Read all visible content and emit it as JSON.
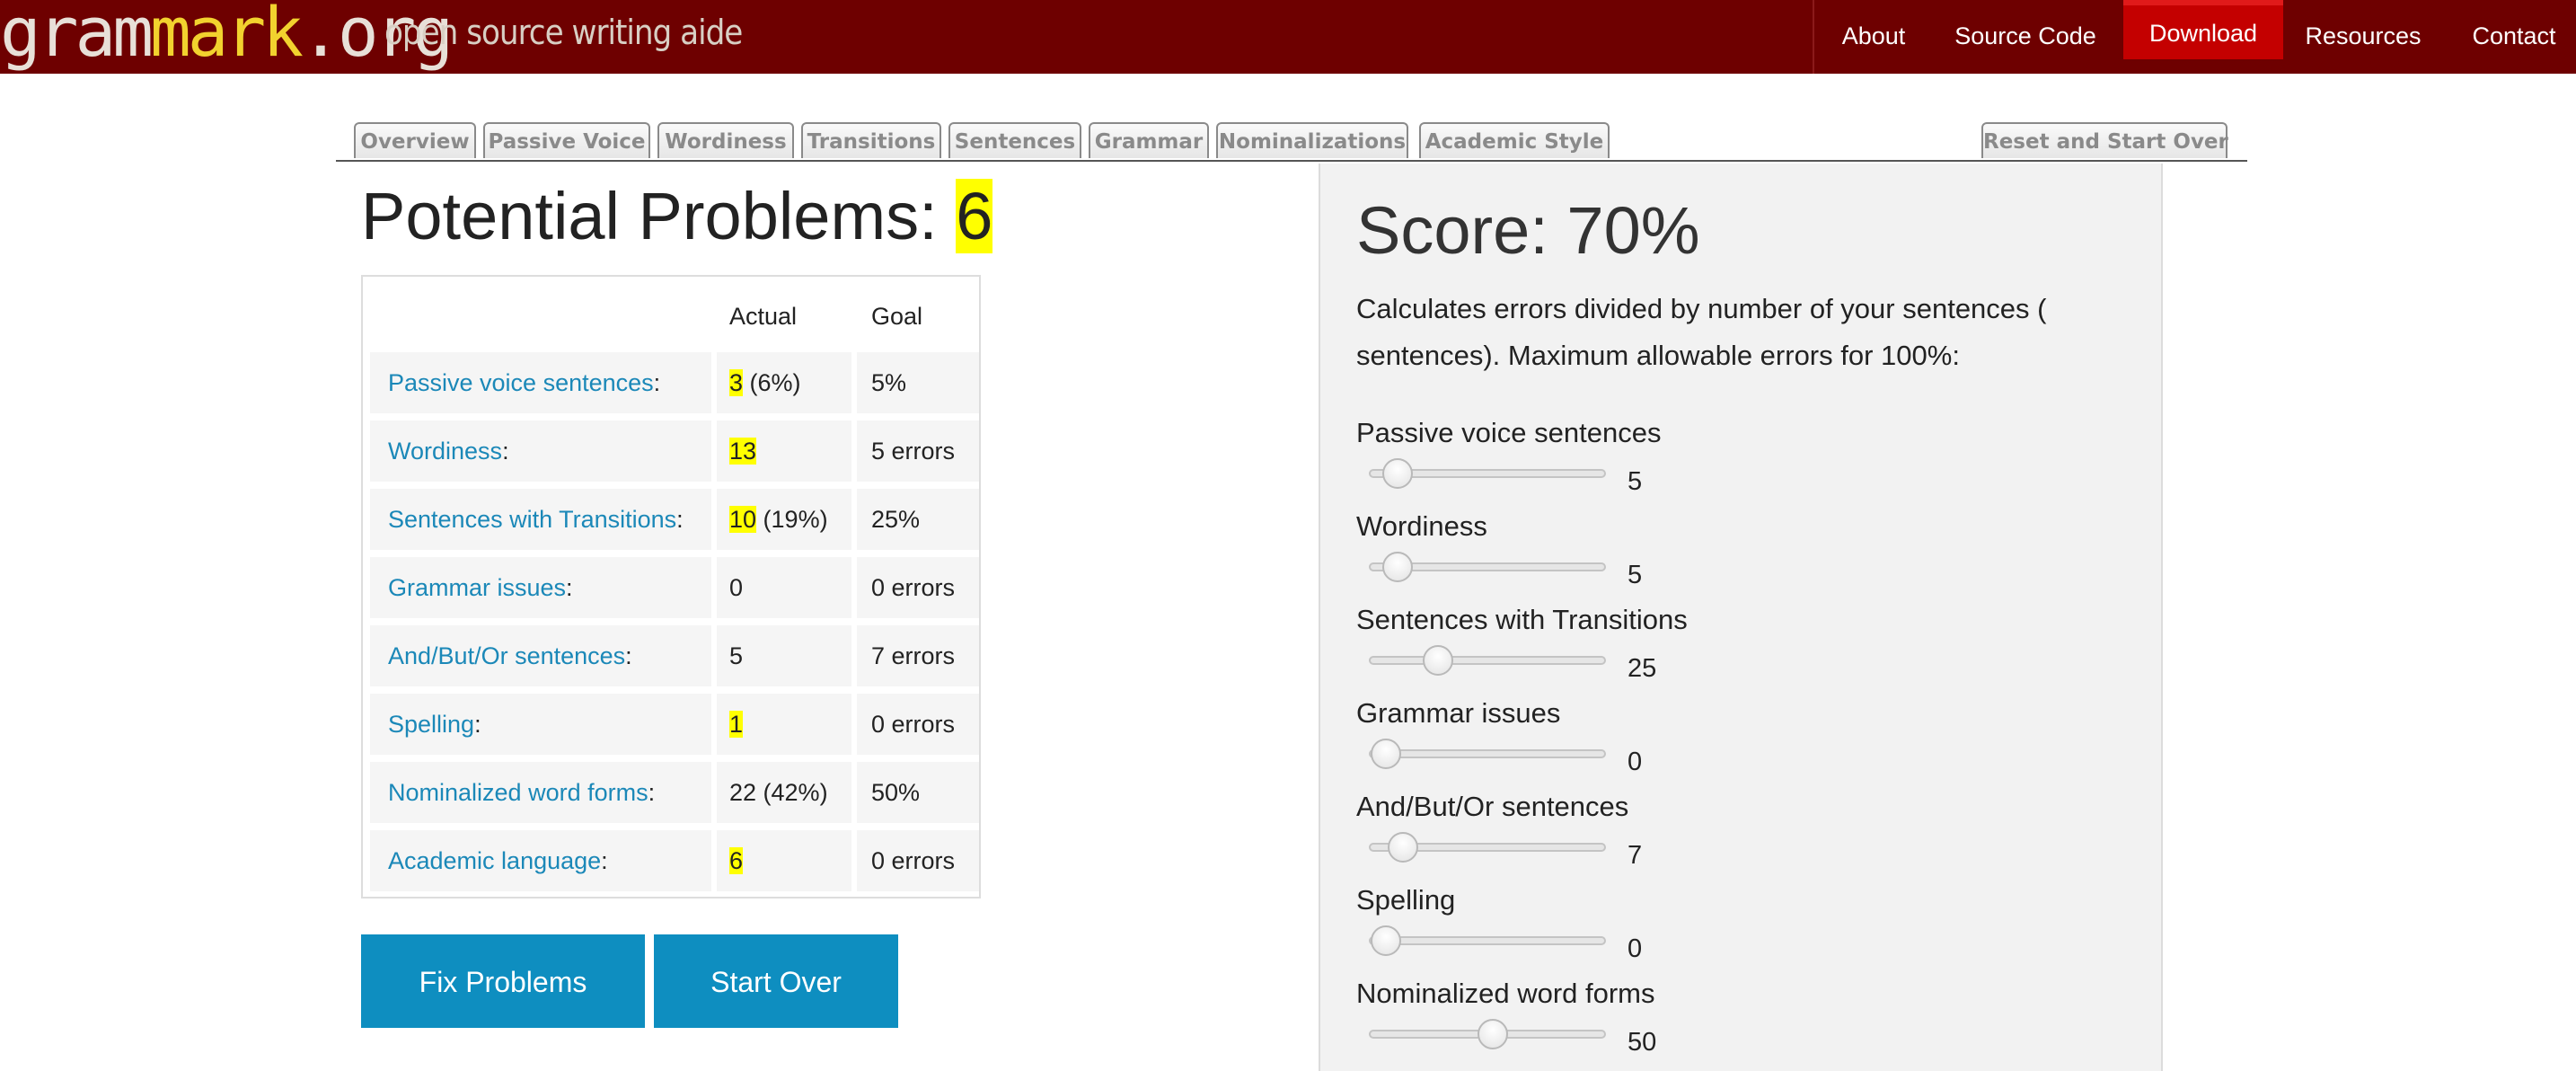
{
  "header": {
    "logo_prefix": "gram",
    "logo_mark": "mark",
    "logo_suffix": ".org",
    "tagline": "open source writing aide",
    "nav": [
      "About",
      "Source Code",
      "Download",
      "Resources",
      "Contact"
    ],
    "active_nav": "Download"
  },
  "tabs": [
    "Overview",
    "Passive Voice",
    "Wordiness",
    "Transitions",
    "Sentences",
    "Grammar",
    "Nominalizations",
    "Academic Style"
  ],
  "reset_tab": "Reset and Start Over",
  "problems": {
    "title": "Potential Problems: ",
    "count": "6",
    "columns": [
      "",
      "Actual",
      "Goal"
    ],
    "rows": [
      {
        "label": "Passive voice sentences",
        "colon": ":",
        "actual_hl": "3",
        "actual_rest": " (6%)",
        "goal": "5%"
      },
      {
        "label": "Wordiness",
        "colon": ":",
        "actual_hl": "13",
        "actual_rest": "",
        "goal": "5 errors"
      },
      {
        "label": "Sentences with Transitions",
        "colon": ":",
        "actual_hl": "10",
        "actual_rest": " (19%)",
        "goal": "25%"
      },
      {
        "label": "Grammar issues",
        "colon": ":",
        "actual_hl": "",
        "actual_rest": "0",
        "goal": "0 errors"
      },
      {
        "label": "And/But/Or sentences",
        "colon": ":",
        "actual_hl": "",
        "actual_rest": "5",
        "goal": "7 errors"
      },
      {
        "label": "Spelling",
        "colon": ":",
        "actual_hl": "1",
        "actual_rest": "",
        "goal": "0 errors"
      },
      {
        "label": "Nominalized word forms",
        "colon": ":",
        "actual_hl": "",
        "actual_rest": "22 (42%)",
        "goal": "50%"
      },
      {
        "label": "Academic language",
        "colon": ":",
        "actual_hl": "6",
        "actual_rest": "",
        "goal": "0 errors"
      }
    ],
    "fix_button": "Fix Problems",
    "start_over_button": "Start Over"
  },
  "score": {
    "title": "Score: 70%",
    "description": "Calculates errors divided by number of your sentences ( sentences). Maximum allowable errors for 100%:",
    "sliders": [
      {
        "label": "Passive voice sentences",
        "value": "5",
        "level": 0.1
      },
      {
        "label": "Wordiness",
        "value": "5",
        "level": 0.1
      },
      {
        "label": "Sentences with Transitions",
        "value": "25",
        "level": 0.27
      },
      {
        "label": "Grammar issues",
        "value": "0",
        "level": 0.05
      },
      {
        "label": "And/But/Or sentences",
        "value": "7",
        "level": 0.12
      },
      {
        "label": "Spelling",
        "value": "0",
        "level": 0.05
      },
      {
        "label": "Nominalized word forms",
        "value": "50",
        "level": 0.5
      }
    ]
  },
  "colors": {
    "header_bg": "#6e0000",
    "active_nav_bg": "#c40000",
    "logo_mark": "#f2d22e",
    "link": "#1b88b8",
    "button": "#0e8ec0",
    "highlight": "#ffff00",
    "panel_bg": "#f2f2f2"
  }
}
